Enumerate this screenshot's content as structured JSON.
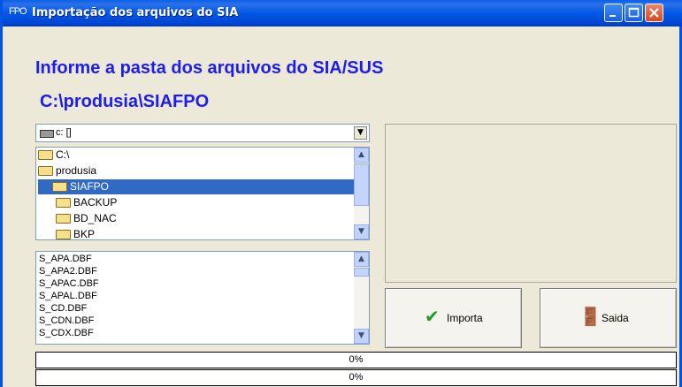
{
  "window": {
    "icon_text": "FPO",
    "title": "Importação dos arquivos do SIA"
  },
  "heading": "Informe a pasta dos arquivos do SIA/SUS",
  "path": "C:\\produsia\\SIAFPO",
  "drive_select": {
    "value": "c: []"
  },
  "folders": [
    {
      "label": "C:\\",
      "open": true,
      "selected": false
    },
    {
      "label": "produsia",
      "open": true,
      "selected": false
    },
    {
      "label": "SIAFPO",
      "open": true,
      "selected": true
    },
    {
      "label": "BACKUP",
      "open": false,
      "selected": false
    },
    {
      "label": "BD_NAC",
      "open": false,
      "selected": false
    },
    {
      "label": "BKP",
      "open": false,
      "selected": false
    }
  ],
  "files": [
    "S_APA.DBF",
    "S_APA2.DBF",
    "S_APAC.DBF",
    "S_APAL.DBF",
    "S_CD.DBF",
    "S_CDN.DBF",
    "S_CDX.DBF"
  ],
  "buttons": {
    "import": "Importa",
    "exit": "Saida"
  },
  "progress": [
    "0%",
    "0%"
  ],
  "colors": {
    "heading": "#1D1DF0",
    "selection": "#316AC5",
    "titlebar": "#0058E6"
  }
}
